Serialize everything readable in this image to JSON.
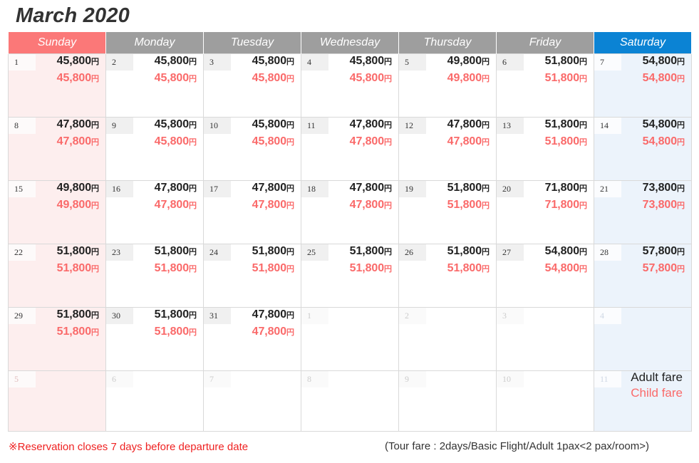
{
  "title": "March 2020",
  "weekday_headers": [
    {
      "label": "Sunday",
      "kind": "sun"
    },
    {
      "label": "Monday",
      "kind": "weekday"
    },
    {
      "label": "Tuesday",
      "kind": "weekday"
    },
    {
      "label": "Wednesday",
      "kind": "weekday"
    },
    {
      "label": "Thursday",
      "kind": "weekday"
    },
    {
      "label": "Friday",
      "kind": "weekday"
    },
    {
      "label": "Saturday",
      "kind": "sat"
    }
  ],
  "currency_symbol": "円",
  "colors": {
    "sunday_header": "#fb7878",
    "weekday_header": "#9e9e9e",
    "saturday_header": "#0b83d4",
    "sunday_cell": "#fdeeee",
    "saturday_cell": "#ecf3fb",
    "adult_price": "#222222",
    "child_price": "#fa6a6a",
    "note": "#ef2222"
  },
  "weeks": [
    [
      {
        "day": "1",
        "in_month": true,
        "adult": "45,800",
        "child": "45,800"
      },
      {
        "day": "2",
        "in_month": true,
        "adult": "45,800",
        "child": "45,800"
      },
      {
        "day": "3",
        "in_month": true,
        "adult": "45,800",
        "child": "45,800"
      },
      {
        "day": "4",
        "in_month": true,
        "adult": "45,800",
        "child": "45,800"
      },
      {
        "day": "5",
        "in_month": true,
        "adult": "49,800",
        "child": "49,800"
      },
      {
        "day": "6",
        "in_month": true,
        "adult": "51,800",
        "child": "51,800"
      },
      {
        "day": "7",
        "in_month": true,
        "adult": "54,800",
        "child": "54,800"
      }
    ],
    [
      {
        "day": "8",
        "in_month": true,
        "adult": "47,800",
        "child": "47,800"
      },
      {
        "day": "9",
        "in_month": true,
        "adult": "45,800",
        "child": "45,800"
      },
      {
        "day": "10",
        "in_month": true,
        "adult": "45,800",
        "child": "45,800"
      },
      {
        "day": "11",
        "in_month": true,
        "adult": "47,800",
        "child": "47,800"
      },
      {
        "day": "12",
        "in_month": true,
        "adult": "47,800",
        "child": "47,800"
      },
      {
        "day": "13",
        "in_month": true,
        "adult": "51,800",
        "child": "51,800"
      },
      {
        "day": "14",
        "in_month": true,
        "adult": "54,800",
        "child": "54,800"
      }
    ],
    [
      {
        "day": "15",
        "in_month": true,
        "adult": "49,800",
        "child": "49,800"
      },
      {
        "day": "16",
        "in_month": true,
        "adult": "47,800",
        "child": "47,800"
      },
      {
        "day": "17",
        "in_month": true,
        "adult": "47,800",
        "child": "47,800"
      },
      {
        "day": "18",
        "in_month": true,
        "adult": "47,800",
        "child": "47,800"
      },
      {
        "day": "19",
        "in_month": true,
        "adult": "51,800",
        "child": "51,800"
      },
      {
        "day": "20",
        "in_month": true,
        "adult": "71,800",
        "child": "71,800"
      },
      {
        "day": "21",
        "in_month": true,
        "adult": "73,800",
        "child": "73,800"
      }
    ],
    [
      {
        "day": "22",
        "in_month": true,
        "adult": "51,800",
        "child": "51,800"
      },
      {
        "day": "23",
        "in_month": true,
        "adult": "51,800",
        "child": "51,800"
      },
      {
        "day": "24",
        "in_month": true,
        "adult": "51,800",
        "child": "51,800"
      },
      {
        "day": "25",
        "in_month": true,
        "adult": "51,800",
        "child": "51,800"
      },
      {
        "day": "26",
        "in_month": true,
        "adult": "51,800",
        "child": "51,800"
      },
      {
        "day": "27",
        "in_month": true,
        "adult": "54,800",
        "child": "54,800"
      },
      {
        "day": "28",
        "in_month": true,
        "adult": "57,800",
        "child": "57,800"
      }
    ],
    [
      {
        "day": "29",
        "in_month": true,
        "adult": "51,800",
        "child": "51,800"
      },
      {
        "day": "30",
        "in_month": true,
        "adult": "51,800",
        "child": "51,800"
      },
      {
        "day": "31",
        "in_month": true,
        "adult": "47,800",
        "child": "47,800"
      },
      {
        "day": "1",
        "in_month": false,
        "adult": "",
        "child": ""
      },
      {
        "day": "2",
        "in_month": false,
        "adult": "",
        "child": ""
      },
      {
        "day": "3",
        "in_month": false,
        "adult": "",
        "child": ""
      },
      {
        "day": "4",
        "in_month": false,
        "adult": "",
        "child": ""
      }
    ],
    [
      {
        "day": "5",
        "in_month": false,
        "adult": "",
        "child": ""
      },
      {
        "day": "6",
        "in_month": false,
        "adult": "",
        "child": ""
      },
      {
        "day": "7",
        "in_month": false,
        "adult": "",
        "child": ""
      },
      {
        "day": "8",
        "in_month": false,
        "adult": "",
        "child": ""
      },
      {
        "day": "9",
        "in_month": false,
        "adult": "",
        "child": ""
      },
      {
        "day": "10",
        "in_month": false,
        "adult": "",
        "child": ""
      },
      {
        "day": "11",
        "in_month": false,
        "adult": "",
        "child": "",
        "legend": true
      }
    ]
  ],
  "legend": {
    "adult_label": "Adult fare",
    "child_label": "Child fare"
  },
  "footer": {
    "note": "※Reservation closes 7 days before departure date",
    "fare_info": "(Tour fare : 2days/Basic Flight/Adult 1pax<2 pax/room>)"
  }
}
